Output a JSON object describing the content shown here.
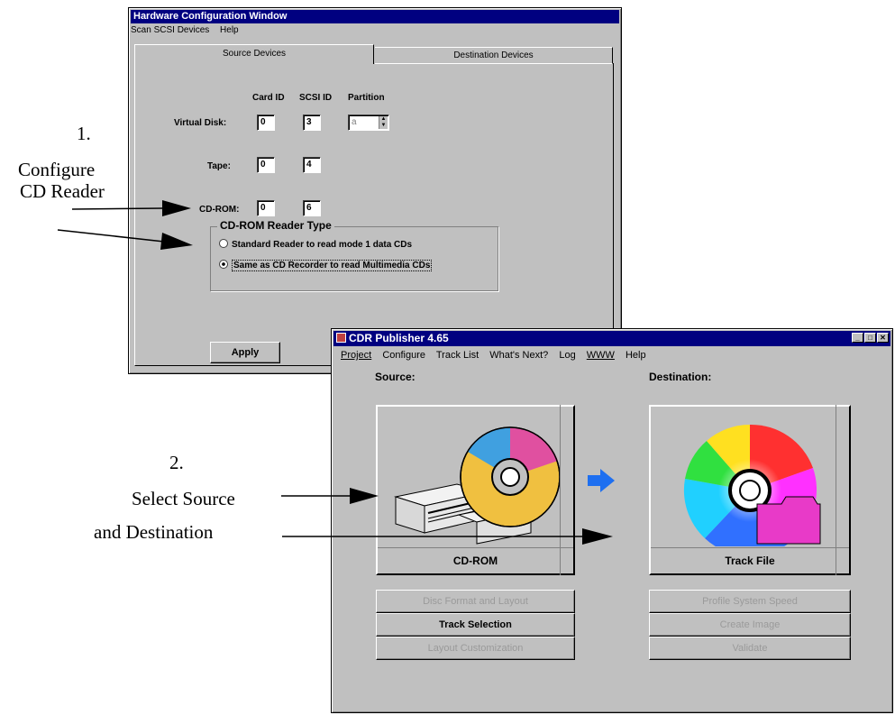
{
  "hw_window": {
    "title": "Hardware Configuration Window",
    "menu": [
      "Scan SCSI Devices",
      "Help"
    ],
    "tabs": [
      "Source Devices",
      "Destination Devices"
    ],
    "col_headers": [
      "Card ID",
      "SCSI ID",
      "Partition"
    ],
    "rows": [
      {
        "label": "Virtual Disk:",
        "card": "0",
        "scsi": "3",
        "partition": "a"
      },
      {
        "label": "Tape:",
        "card": "0",
        "scsi": "4"
      },
      {
        "label": "CD-ROM:",
        "card": "0",
        "scsi": "6"
      }
    ],
    "reader_group": {
      "title": "CD-ROM Reader Type",
      "options": [
        "Standard Reader to read mode 1 data CDs",
        "Same as CD Recorder to read Multimedia CDs"
      ],
      "selected": 1
    },
    "apply_label": "Apply"
  },
  "cdr_window": {
    "title": "CDR Publisher 4.65",
    "menu": [
      "Project",
      "Configure",
      "Track List",
      "What's Next?",
      "Log",
      "WWW",
      "Help"
    ],
    "source_label": "Source:",
    "destination_label": "Destination:",
    "source_device": "CD-ROM",
    "destination_device": "Track File",
    "left_buttons": [
      {
        "label": "Disc Format and Layout",
        "enabled": false
      },
      {
        "label": "Track Selection",
        "enabled": true
      },
      {
        "label": "Layout Customization",
        "enabled": false
      }
    ],
    "right_buttons": [
      {
        "label": "Profile System Speed",
        "enabled": false
      },
      {
        "label": "Create Image",
        "enabled": false
      },
      {
        "label": "Validate",
        "enabled": false
      }
    ]
  },
  "annotations": {
    "step1": {
      "number": "1.",
      "lines": [
        "Configure",
        "CD Reader"
      ]
    },
    "step2": {
      "number": "2.",
      "lines": [
        "Select Source",
        "and Destination"
      ]
    }
  },
  "colors": {
    "titlebar": "#000080",
    "window_bg": "#c0c0c0",
    "arrow": "#1e6ff0",
    "folder": "#e83ac8"
  }
}
